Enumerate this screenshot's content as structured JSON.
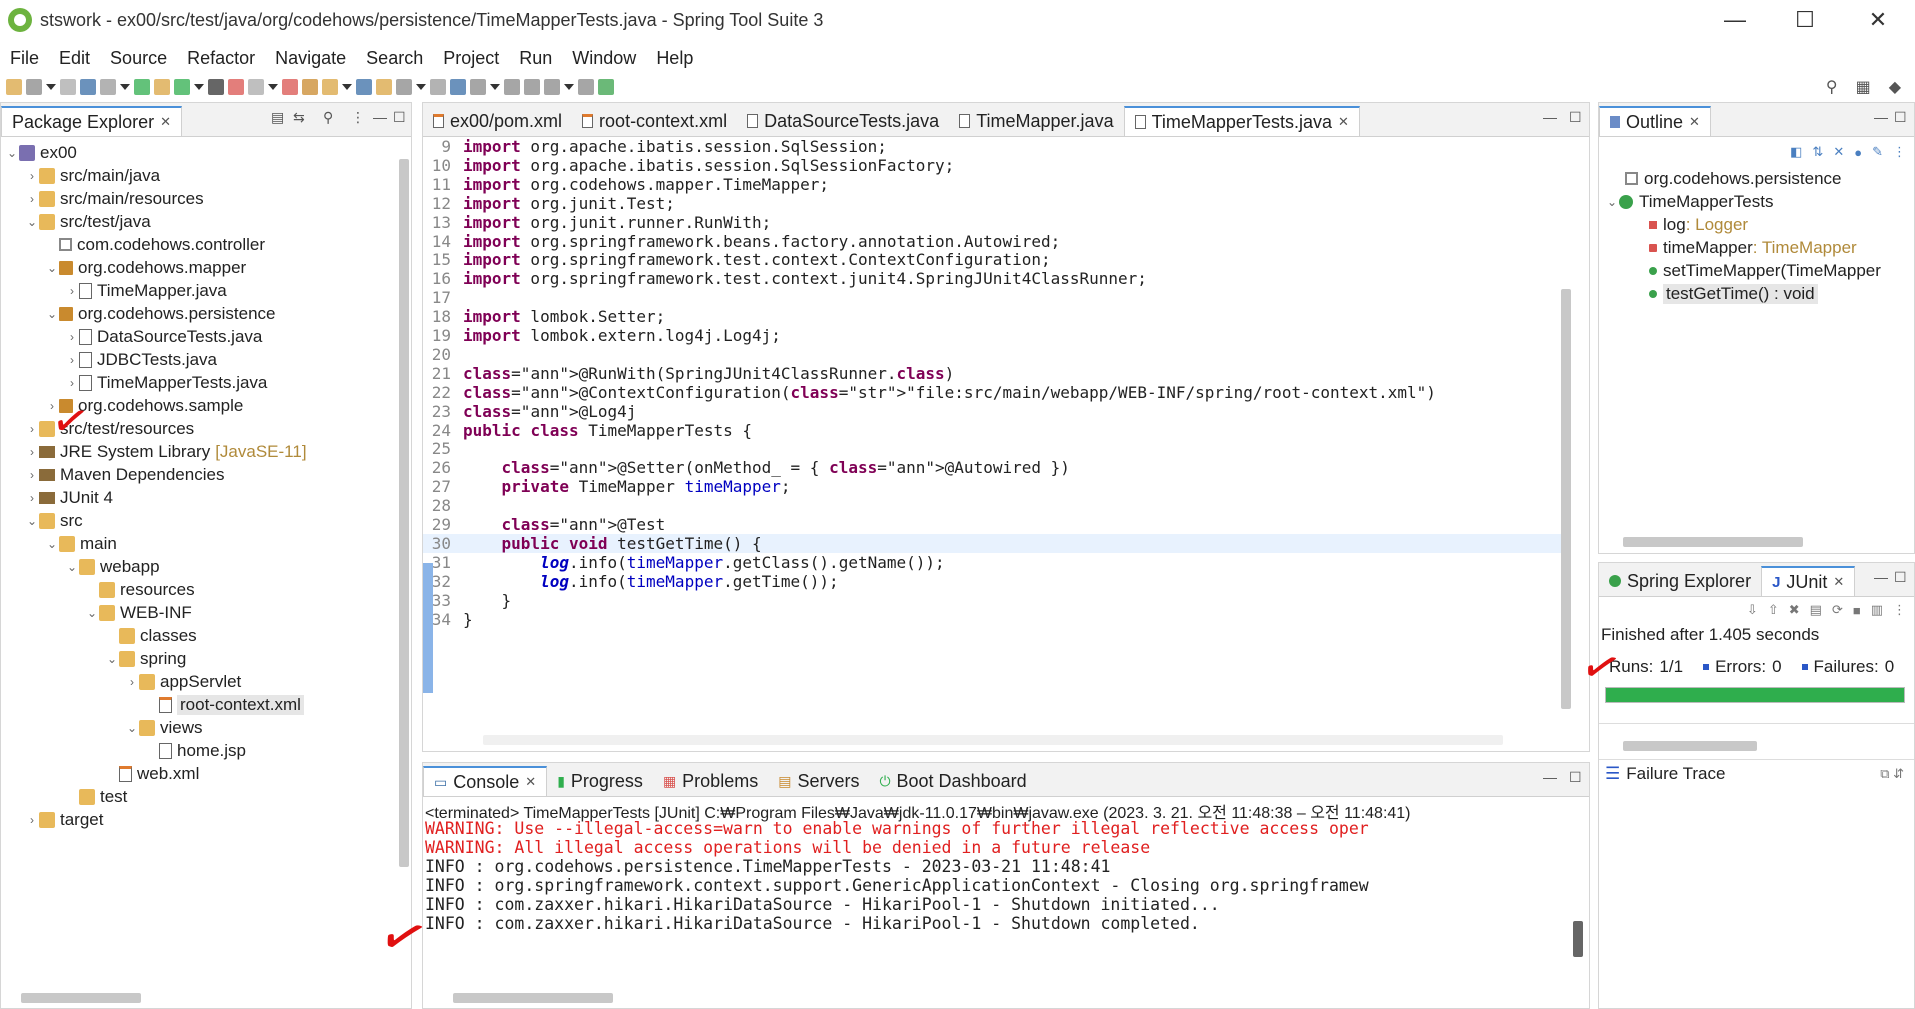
{
  "window": {
    "title": "stswork - ex00/src/test/java/org/codehows/persistence/TimeMapperTests.java - Spring Tool Suite 3",
    "minimize": "—",
    "maximize": "☐",
    "close": "✕"
  },
  "menu": [
    "File",
    "Edit",
    "Source",
    "Refactor",
    "Navigate",
    "Search",
    "Project",
    "Run",
    "Window",
    "Help"
  ],
  "package_explorer": {
    "tab_label": "Package Explorer",
    "tree": [
      {
        "label": "ex00",
        "chev": "v",
        "icon": "proj"
      },
      {
        "label": "src/main/java",
        "chev": ">",
        "icon": "folder"
      },
      {
        "label": "src/main/resources",
        "chev": ">",
        "icon": "folder"
      },
      {
        "label": "src/test/java",
        "chev": "v",
        "icon": "folder"
      },
      {
        "label": "com.codehows.controller",
        "chev": "",
        "icon": "pkg-empty"
      },
      {
        "label": "org.codehows.mapper",
        "chev": "v",
        "icon": "pkg"
      },
      {
        "label": "TimeMapper.java",
        "chev": ">",
        "icon": "java"
      },
      {
        "label": "org.codehows.persistence",
        "chev": "v",
        "icon": "pkg"
      },
      {
        "label": "DataSourceTests.java",
        "chev": ">",
        "icon": "java"
      },
      {
        "label": "JDBCTests.java",
        "chev": ">",
        "icon": "java"
      },
      {
        "label": "TimeMapperTests.java",
        "chev": ">",
        "icon": "java"
      },
      {
        "label": "org.codehows.sample",
        "chev": ">",
        "icon": "pkg"
      },
      {
        "label": "src/test/resources",
        "chev": ">",
        "icon": "folder"
      },
      {
        "label": "JRE System Library",
        "suffix": "[JavaSE-11]",
        "chev": ">",
        "icon": "lib"
      },
      {
        "label": "Maven Dependencies",
        "chev": ">",
        "icon": "lib"
      },
      {
        "label": "JUnit 4",
        "chev": ">",
        "icon": "lib"
      },
      {
        "label": "src",
        "chev": "v",
        "icon": "folder"
      },
      {
        "label": "main",
        "chev": "v",
        "icon": "folder"
      },
      {
        "label": "webapp",
        "chev": "v",
        "icon": "folder"
      },
      {
        "label": "resources",
        "chev": "",
        "icon": "folder"
      },
      {
        "label": "WEB-INF",
        "chev": "v",
        "icon": "folder"
      },
      {
        "label": "classes",
        "chev": "",
        "icon": "folder"
      },
      {
        "label": "spring",
        "chev": "v",
        "icon": "folder"
      },
      {
        "label": "appServlet",
        "chev": ">",
        "icon": "folder"
      },
      {
        "label": "root-context.xml",
        "chev": "",
        "icon": "xml",
        "selected": true
      },
      {
        "label": "views",
        "chev": "v",
        "icon": "folder"
      },
      {
        "label": "home.jsp",
        "chev": "",
        "icon": "java"
      },
      {
        "label": "web.xml",
        "chev": "",
        "icon": "xml"
      },
      {
        "label": "test",
        "chev": "",
        "icon": "folder"
      },
      {
        "label": "target",
        "chev": ">",
        "icon": "folder"
      }
    ]
  },
  "editor": {
    "tabs": [
      "ex00/pom.xml",
      "root-context.xml",
      "DataSourceTests.java",
      "TimeMapper.java",
      "TimeMapperTests.java"
    ],
    "active_tab": 4,
    "lines": [
      {
        "n": "9",
        "text": "import org.apache.ibatis.session.SqlSession;"
      },
      {
        "n": "10",
        "text": "import org.apache.ibatis.session.SqlSessionFactory;"
      },
      {
        "n": "11",
        "text": "import org.codehows.mapper.TimeMapper;"
      },
      {
        "n": "12",
        "text": "import org.junit.Test;"
      },
      {
        "n": "13",
        "text": "import org.junit.runner.RunWith;"
      },
      {
        "n": "14",
        "text": "import org.springframework.beans.factory.annotation.Autowired;"
      },
      {
        "n": "15",
        "text": "import org.springframework.test.context.ContextConfiguration;"
      },
      {
        "n": "16",
        "text": "import org.springframework.test.context.junit4.SpringJUnit4ClassRunner;"
      },
      {
        "n": "17",
        "text": ""
      },
      {
        "n": "18",
        "text": "import lombok.Setter;"
      },
      {
        "n": "19",
        "text": "import lombok.extern.log4j.Log4j;"
      },
      {
        "n": "20",
        "text": ""
      },
      {
        "n": "21",
        "text": "@RunWith(SpringJUnit4ClassRunner.class)"
      },
      {
        "n": "22",
        "text": "@ContextConfiguration(\"file:src/main/webapp/WEB-INF/spring/root-context.xml\")"
      },
      {
        "n": "23",
        "text": "@Log4j"
      },
      {
        "n": "24",
        "text": "public class TimeMapperTests {"
      },
      {
        "n": "25",
        "text": ""
      },
      {
        "n": "26",
        "text": "    @Setter(onMethod_ = { @Autowired })"
      },
      {
        "n": "27",
        "text": "    private TimeMapper timeMapper;"
      },
      {
        "n": "28",
        "text": ""
      },
      {
        "n": "29",
        "text": "    @Test"
      },
      {
        "n": "30",
        "text": "    public void testGetTime() {"
      },
      {
        "n": "31",
        "text": "        log.info(timeMapper.getClass().getName());"
      },
      {
        "n": "32",
        "text": "        log.info(timeMapper.getTime());"
      },
      {
        "n": "33",
        "text": "    }"
      },
      {
        "n": "34",
        "text": "}"
      }
    ]
  },
  "outline": {
    "tab_label": "Outline",
    "items": [
      {
        "label": "org.codehows.persistence",
        "type": ""
      },
      {
        "label": "TimeMapperTests",
        "type": ""
      },
      {
        "label": "log",
        "type": " : Logger"
      },
      {
        "label": "timeMapper",
        "type": " : TimeMapper"
      },
      {
        "label": "setTimeMapper(TimeMapper",
        "type": ""
      },
      {
        "label": "testGetTime() : void",
        "type": ""
      }
    ]
  },
  "junit": {
    "tab_spring": "Spring Explorer",
    "tab_junit": "JUnit",
    "finished": "Finished after 1.405 seconds",
    "runs_label": "Runs:",
    "runs_value": "1/1",
    "errors_label": "Errors:",
    "errors_value": "0",
    "failures_label": "Failures:",
    "failures_value": "0",
    "progress": 1.0,
    "failure_trace": "Failure Trace",
    "bar_color": "#2fae4d"
  },
  "console": {
    "tabs": [
      "Console",
      "Progress",
      "Problems",
      "Servers",
      "Boot Dashboard"
    ],
    "header": "<terminated> TimeMapperTests [JUnit] C:₩Program Files₩Java₩jdk-11.0.17₩bin₩javaw.exe  (2023. 3. 21. 오전 11:48:38 – 오전 11:48:41)",
    "lines": [
      {
        "kind": "warn",
        "text": "WARNING: Use --illegal-access=warn to enable warnings of further illegal reflective access oper"
      },
      {
        "kind": "warn",
        "text": "WARNING: All illegal access operations will be denied in a future release"
      },
      {
        "kind": "info",
        "text": "INFO : org.codehows.persistence.TimeMapperTests - 2023-03-21 11:48:41"
      },
      {
        "kind": "info",
        "text": "INFO : org.springframework.context.support.GenericApplicationContext - Closing org.springframew"
      },
      {
        "kind": "info",
        "text": "INFO : com.zaxxer.hikari.HikariDataSource - HikariPool-1 - Shutdown initiated..."
      },
      {
        "kind": "info",
        "text": "INFO : com.zaxxer.hikari.HikariDataSource - HikariPool-1 - Shutdown completed."
      }
    ]
  }
}
